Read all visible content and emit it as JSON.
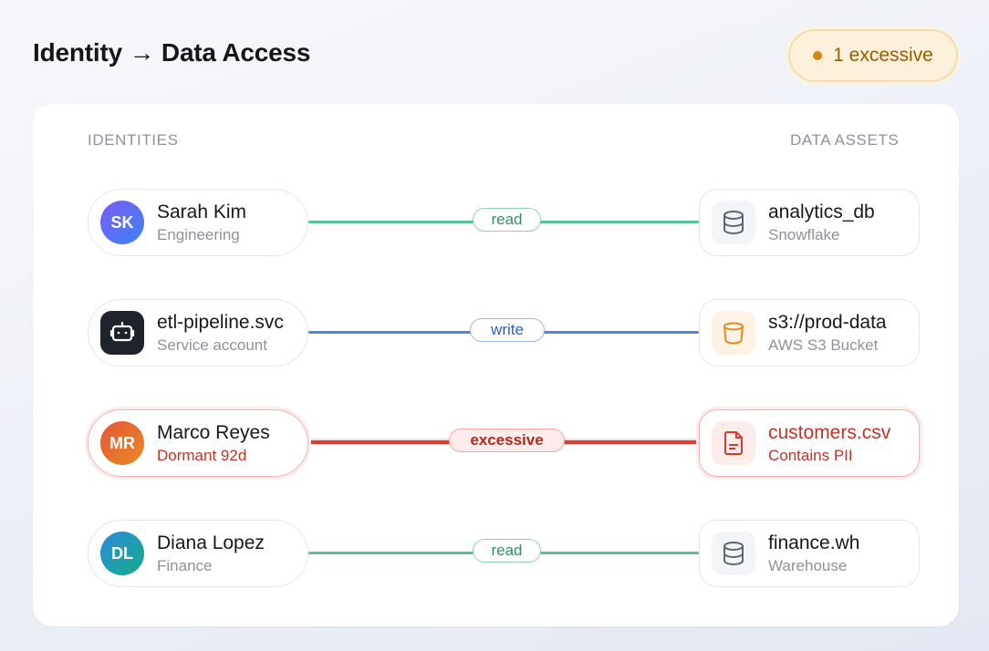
{
  "title": "Identity → Data Access",
  "badge": {
    "label": "1 excessive",
    "color": "#d4870f"
  },
  "columns": {
    "left": "IDENTITIES",
    "right": "DATA ASSETS"
  },
  "rows": [
    {
      "identity": {
        "initials": "SK",
        "name": "Sarah Kim",
        "subtitle": "Engineering",
        "avatar_colors": [
          "#6c5cf0",
          "#3f7df4"
        ]
      },
      "edge": {
        "label": "read",
        "color": "#5dbf95"
      },
      "asset": {
        "name": "analytics_db",
        "subtitle": "Snowflake",
        "icon": "database-icon"
      }
    },
    {
      "identity": {
        "initials": "",
        "name": "etl-pipeline.svc",
        "subtitle": "Service account",
        "icon": "robot-icon"
      },
      "edge": {
        "label": "write",
        "color": "#5584e0"
      },
      "asset": {
        "name": "s3://prod-data",
        "subtitle": "AWS S3 Bucket",
        "icon": "bucket-icon"
      }
    },
    {
      "identity": {
        "initials": "MR",
        "name": "Marco Reyes",
        "subtitle": "Dormant 92d",
        "avatar_colors": [
          "#e2553a",
          "#e98524"
        ]
      },
      "edge": {
        "label": "excessive",
        "color": "#d63f34"
      },
      "asset": {
        "name": "customers.csv",
        "subtitle": "Contains PII",
        "icon": "file-icon"
      }
    },
    {
      "identity": {
        "initials": "DL",
        "name": "Diana Lopez",
        "subtitle": "Finance",
        "avatar_colors": [
          "#2a8fd9",
          "#18a98a"
        ]
      },
      "edge": {
        "label": "read",
        "color": "#5dbf95"
      },
      "asset": {
        "name": "finance.wh",
        "subtitle": "Warehouse",
        "icon": "database-icon"
      }
    }
  ]
}
